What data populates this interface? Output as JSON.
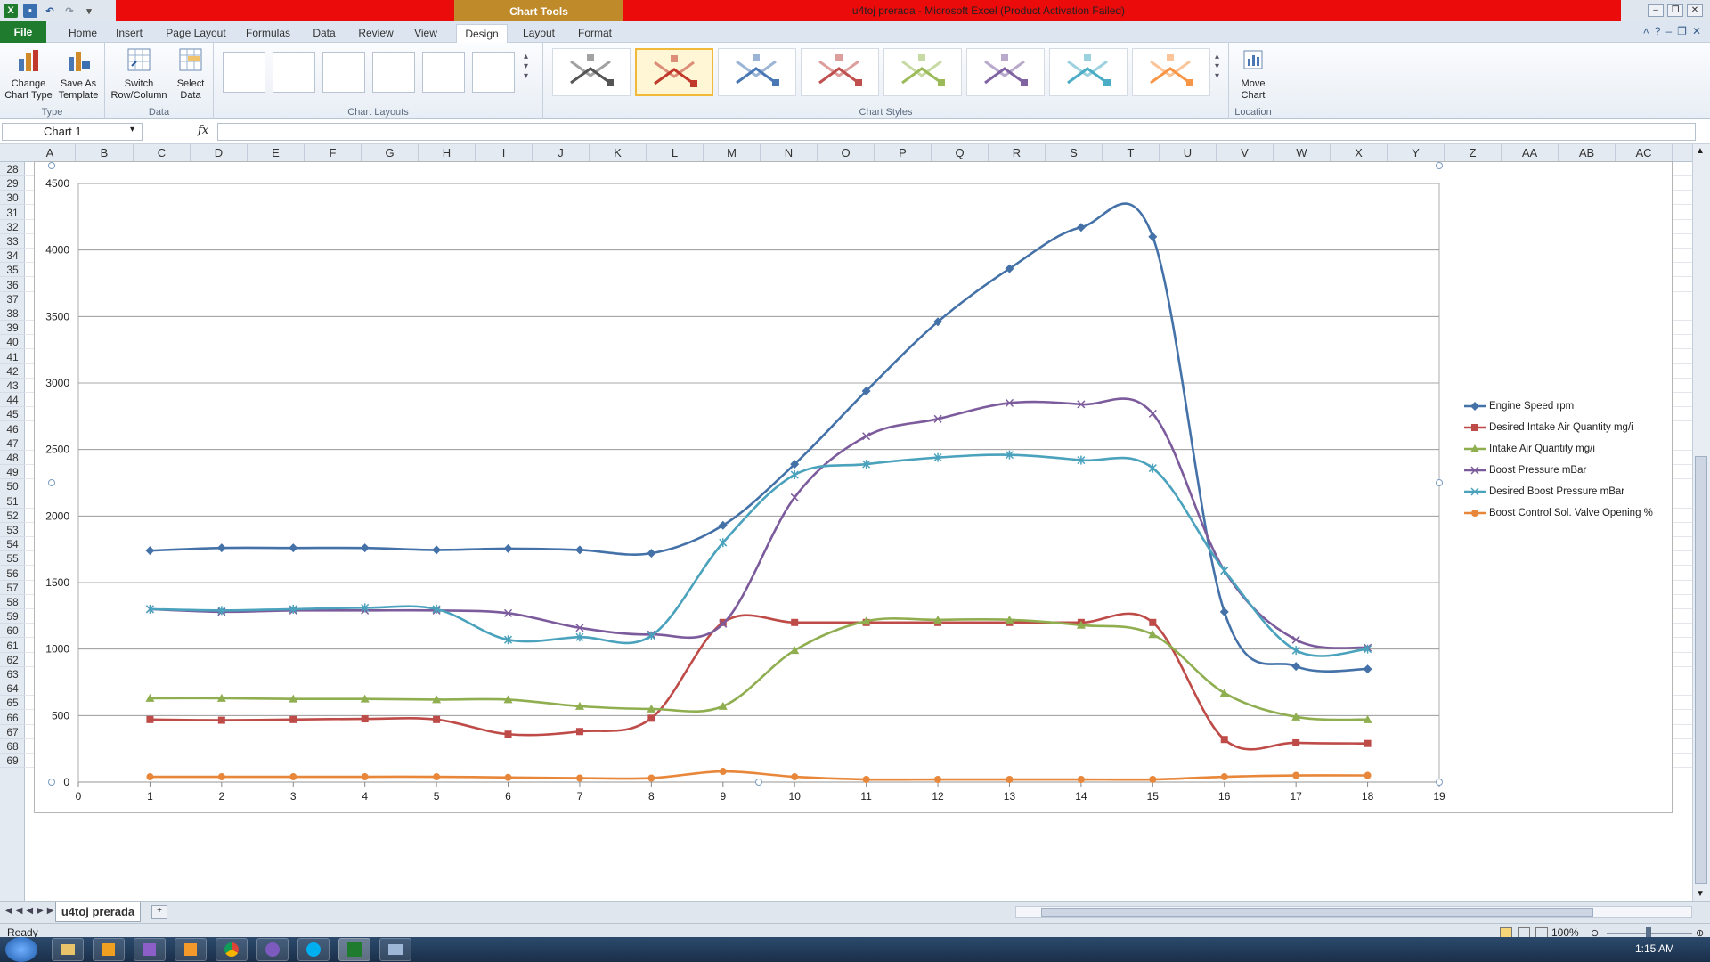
{
  "app": {
    "window_title": "u4toj prerada  -  Microsoft Excel (Product Activation Failed)",
    "contextual_tab": "Chart Tools"
  },
  "ribbon_tabs": [
    "File",
    "Home",
    "Insert",
    "Page Layout",
    "Formulas",
    "Data",
    "Review",
    "View",
    "Design",
    "Layout",
    "Format"
  ],
  "ribbon": {
    "type_group": {
      "label": "Type",
      "buttons": [
        {
          "line1": "Change",
          "line2": "Chart Type"
        },
        {
          "line1": "Save As",
          "line2": "Template"
        }
      ]
    },
    "data_group": {
      "label": "Data",
      "buttons": [
        {
          "line1": "Switch",
          "line2": "Row/Column"
        },
        {
          "line1": "Select",
          "line2": "Data"
        }
      ]
    },
    "layouts_group": {
      "label": "Chart Layouts"
    },
    "styles_group": {
      "label": "Chart Styles",
      "colors": [
        "#555555",
        "#c0392b",
        "#4a78b5",
        "#c0504d",
        "#9bbb59",
        "#8064a2",
        "#4bacc6",
        "#f79646"
      ]
    },
    "location_group": {
      "label": "Location",
      "buttons": [
        {
          "line1": "Move",
          "line2": "Chart"
        }
      ]
    }
  },
  "formula_bar": {
    "name_box": "Chart 1",
    "fx": "fx",
    "value": ""
  },
  "columns": [
    "A",
    "B",
    "C",
    "D",
    "E",
    "F",
    "G",
    "H",
    "I",
    "J",
    "K",
    "L",
    "M",
    "N",
    "O",
    "P",
    "Q",
    "R",
    "S",
    "T",
    "U",
    "V",
    "W",
    "X",
    "Y",
    "Z",
    "AA",
    "AB",
    "AC"
  ],
  "rows": [
    28,
    29,
    30,
    31,
    32,
    33,
    34,
    35,
    36,
    37,
    38,
    39,
    40,
    41,
    42,
    43,
    44,
    45,
    46,
    47,
    48,
    49,
    50,
    51,
    52,
    53,
    54,
    55,
    56,
    57,
    58,
    59,
    60,
    61,
    62,
    63,
    64,
    65,
    66,
    67,
    68,
    69
  ],
  "sheet_tab": "u4toj prerada",
  "status": {
    "ready": "Ready",
    "zoom": "100%"
  },
  "clock": "1:15 AM",
  "chart_data": {
    "type": "scatter",
    "x": [
      1,
      2,
      3,
      4,
      5,
      6,
      7,
      8,
      9,
      10,
      11,
      12,
      13,
      14,
      15,
      16,
      17,
      18
    ],
    "xlim": [
      0,
      19
    ],
    "ylim": [
      0,
      4500
    ],
    "x_ticks": [
      0,
      1,
      2,
      3,
      4,
      5,
      6,
      7,
      8,
      9,
      10,
      11,
      12,
      13,
      14,
      15,
      16,
      17,
      18,
      19
    ],
    "y_ticks": [
      0,
      500,
      1000,
      1500,
      2000,
      2500,
      3000,
      3500,
      4000,
      4500
    ],
    "grid": true,
    "legend_position": "right",
    "series": [
      {
        "name": "Engine Speed rpm",
        "color": "#4472a8",
        "marker": "diamond",
        "values": [
          1740,
          1760,
          1760,
          1760,
          1745,
          1755,
          1745,
          1720,
          1930,
          2390,
          2940,
          3460,
          3860,
          4170,
          4100,
          1280,
          870,
          850
        ]
      },
      {
        "name": "Desired Intake Air Quantity mg/i",
        "color": "#be4b48",
        "marker": "square",
        "values": [
          470,
          465,
          470,
          475,
          470,
          360,
          380,
          480,
          1200,
          1200,
          1200,
          1200,
          1200,
          1200,
          1200,
          320,
          295,
          290
        ]
      },
      {
        "name": "Intake Air Quantity mg/i",
        "color": "#8fae4f",
        "marker": "triangle",
        "values": [
          630,
          630,
          625,
          625,
          620,
          620,
          570,
          550,
          570,
          990,
          1210,
          1220,
          1220,
          1180,
          1110,
          670,
          490,
          470
        ]
      },
      {
        "name": "Boost Pressure mBar",
        "color": "#7c5b9c",
        "marker": "x",
        "values": [
          1300,
          1280,
          1290,
          1290,
          1290,
          1270,
          1160,
          1110,
          1190,
          2140,
          2600,
          2730,
          2850,
          2840,
          2770,
          1590,
          1070,
          1010
        ]
      },
      {
        "name": "Desired Boost Pressure mBar",
        "color": "#4aa2bd",
        "marker": "star",
        "values": [
          1300,
          1290,
          1300,
          1310,
          1300,
          1070,
          1090,
          1100,
          1800,
          2310,
          2390,
          2440,
          2460,
          2420,
          2360,
          1590,
          990,
          1000
        ]
      },
      {
        "name": "Boost Control Sol. Valve Opening %",
        "color": "#e8873a",
        "marker": "circle",
        "values": [
          40,
          40,
          40,
          40,
          40,
          35,
          30,
          30,
          80,
          40,
          20,
          20,
          20,
          20,
          20,
          40,
          50,
          50
        ]
      }
    ]
  }
}
